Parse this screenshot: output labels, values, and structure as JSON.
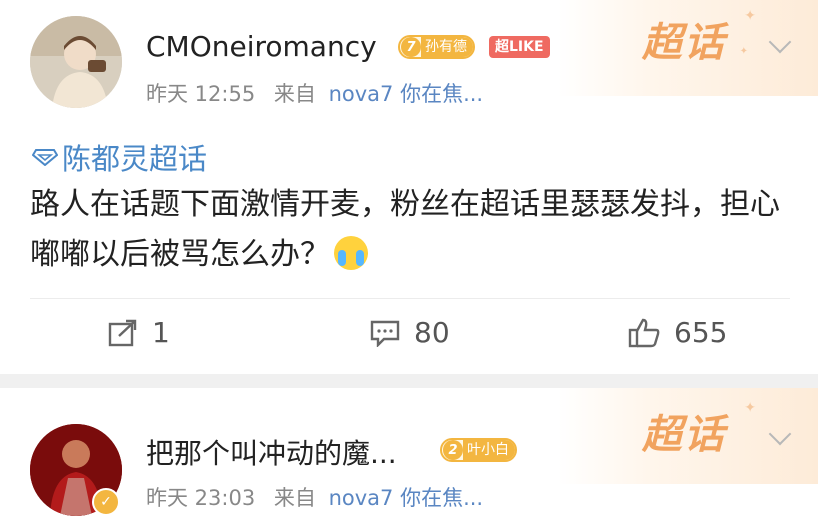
{
  "supertopic_badge": "超话",
  "posts": [
    {
      "username": "CMOneiromancy",
      "level_badge": {
        "level": "7",
        "name": "孙有德"
      },
      "superlike_badge": "超LIKE",
      "meta": {
        "time": "昨天 12:55",
        "from_label": "来自",
        "source": "nova7 你在焦..."
      },
      "topic": "陈都灵超话",
      "text": "路人在话题下面激情开麦，粉丝在超话里瑟瑟发抖，担心嘟嘟以后被骂怎么办？",
      "actions": {
        "repost": "1",
        "comment": "80",
        "like": "655"
      }
    },
    {
      "username": "把那个叫冲动的魔...",
      "level_badge": {
        "level": "2",
        "name": "叶小白"
      },
      "meta": {
        "time": "昨天 23:03",
        "from_label": "来自",
        "source": "nova7 你在焦..."
      }
    }
  ],
  "colors": {
    "link": "#4a88c7",
    "supertopic": "#f1a35f",
    "level_badge": "#f3b640",
    "superlike": "#ef6a61"
  },
  "icons": [
    "supertopic-diamond-icon",
    "repost-icon",
    "comment-icon",
    "like-icon",
    "chevron-down-icon",
    "crying-face-emoji",
    "verified-badge-icon"
  ]
}
